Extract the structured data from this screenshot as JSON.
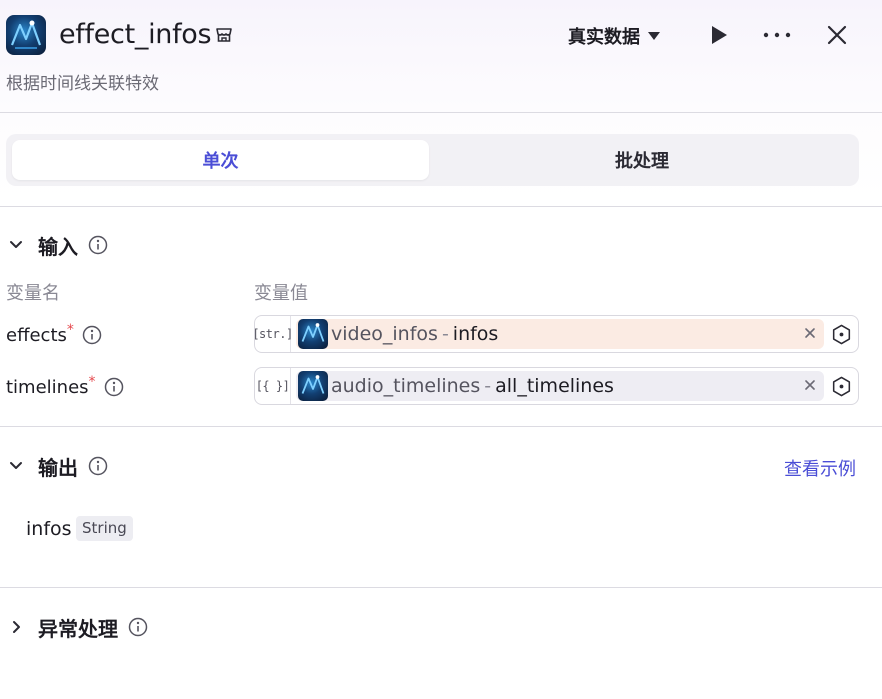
{
  "header": {
    "title": "effect_infos",
    "subtitle": "根据时间线关联特效",
    "data_mode": "真实数据"
  },
  "tabs": [
    {
      "label": "单次",
      "active": true
    },
    {
      "label": "批处理",
      "active": false
    }
  ],
  "input": {
    "title": "输入",
    "col_name": "变量名",
    "col_value": "变量值",
    "params": [
      {
        "name": "effects",
        "required_mark": "*",
        "type_tag": "[str.]",
        "source": "video_infos",
        "sep": "-",
        "field": "infos",
        "chip_color": "#fbebe3"
      },
      {
        "name": "timelines",
        "required_mark": "*",
        "type_tag": "[{ }]",
        "source": "audio_timelines",
        "sep": "-",
        "field": "all_timelines",
        "chip_color": "#eeedf3"
      }
    ]
  },
  "output": {
    "title": "输出",
    "example_link": "查看示例",
    "fields": [
      {
        "name": "infos",
        "type": "String"
      }
    ]
  },
  "exception": {
    "title": "异常处理"
  },
  "colors": {
    "accent": "#4b4ed6",
    "required": "#e5484d"
  }
}
